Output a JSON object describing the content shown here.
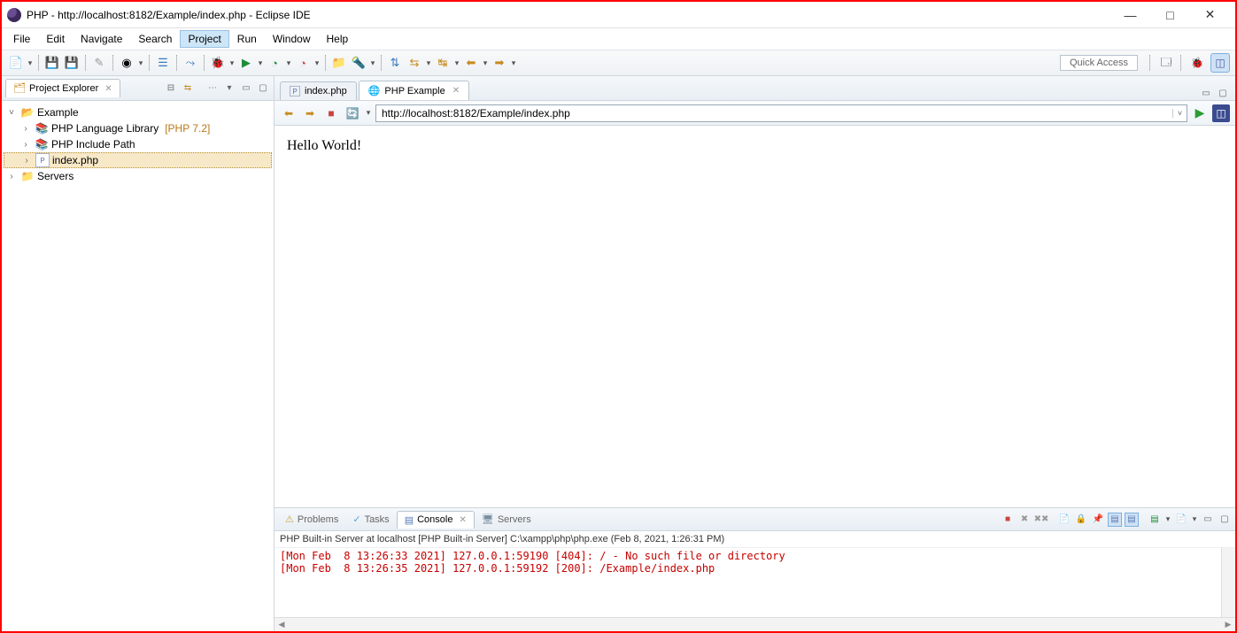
{
  "window": {
    "title": "PHP - http://localhost:8182/Example/index.php - Eclipse IDE"
  },
  "menubar": [
    "File",
    "Edit",
    "Navigate",
    "Search",
    "Project",
    "Run",
    "Window",
    "Help"
  ],
  "menubar_active_index": 4,
  "quick_access_label": "Quick Access",
  "project_explorer": {
    "tab_label": "Project Explorer",
    "tree": {
      "root": "Example",
      "lib": {
        "label": "PHP Language Library",
        "badge": "[PHP 7.2]"
      },
      "include": "PHP Include Path",
      "file": "index.php",
      "servers": "Servers"
    }
  },
  "editor": {
    "tabs": [
      {
        "label": "index.php",
        "active": false
      },
      {
        "label": "PHP Example",
        "active": true
      }
    ],
    "browser": {
      "url": "http://localhost:8182/Example/index.php",
      "content": "Hello World!"
    }
  },
  "bottom": {
    "tabs": [
      "Problems",
      "Tasks",
      "Console",
      "Servers"
    ],
    "active_index": 2,
    "console_header": "PHP Built-in Server at localhost [PHP Built-in Server] C:\\xampp\\php\\php.exe (Feb 8, 2021, 1:26:31 PM)",
    "console_lines": [
      "[Mon Feb  8 13:26:33 2021] 127.0.0.1:59190 [404]: / - No such file or directory",
      "[Mon Feb  8 13:26:35 2021] 127.0.0.1:59192 [200]: /Example/index.php"
    ]
  }
}
